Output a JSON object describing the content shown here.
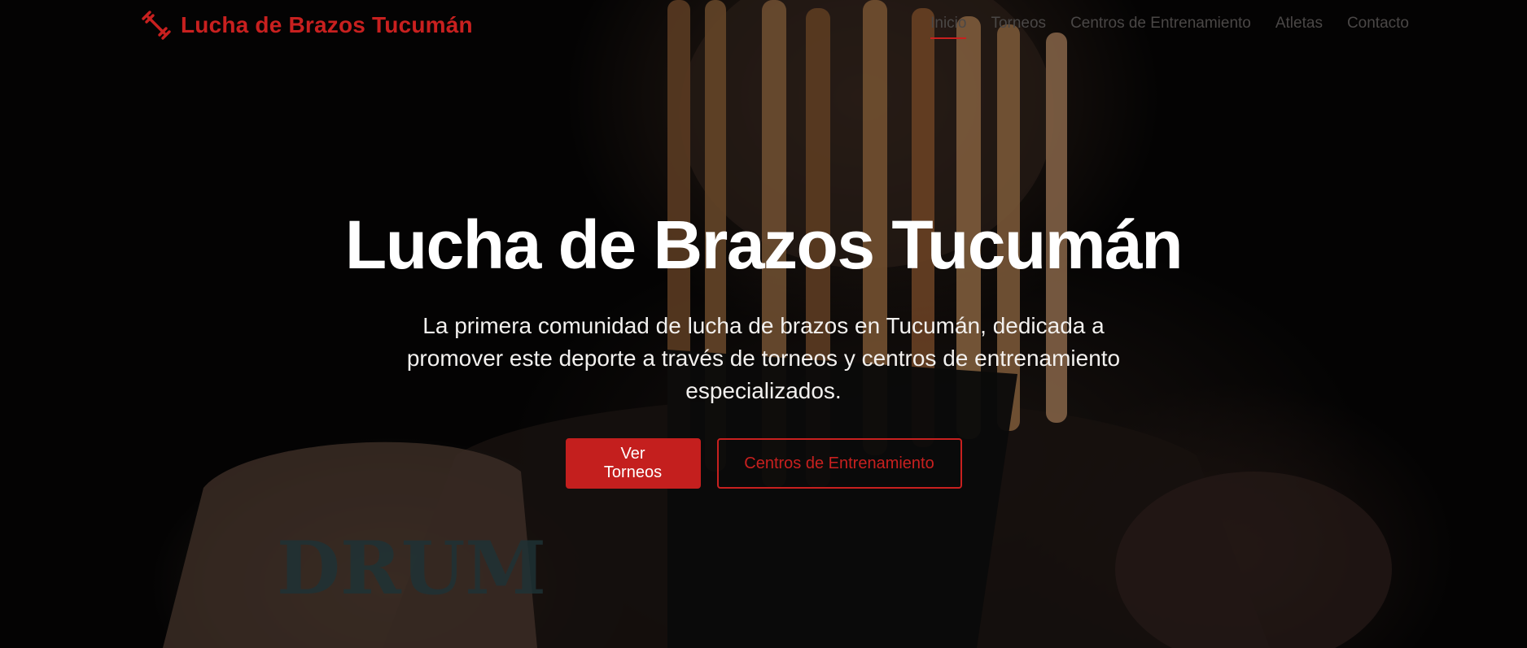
{
  "brand": {
    "name": "Lucha de Brazos Tucumán",
    "icon": "dumbbell-icon",
    "color": "#c8201f"
  },
  "nav": {
    "items": [
      {
        "label": "Inicio",
        "active": true
      },
      {
        "label": "Torneos",
        "active": false
      },
      {
        "label": "Centros de Entrenamiento",
        "active": false
      },
      {
        "label": "Atletas",
        "active": false
      },
      {
        "label": "Contacto",
        "active": false
      }
    ]
  },
  "hero": {
    "title": "Lucha de Brazos Tucumán",
    "subtitle": "La primera comunidad de lucha de brazos en Tucumán, dedicada a promover este deporte a través de torneos y centros de entrenamiento especializados.",
    "primary_button": "Ver Torneos",
    "secondary_button": "Centros de Entrenamiento",
    "background_image": "man-holding-drumsticks-photo",
    "background_text": "DRUM"
  },
  "colors": {
    "accent": "#c41f1e",
    "nav_text": "#4a4746",
    "title": "#ffffff"
  }
}
